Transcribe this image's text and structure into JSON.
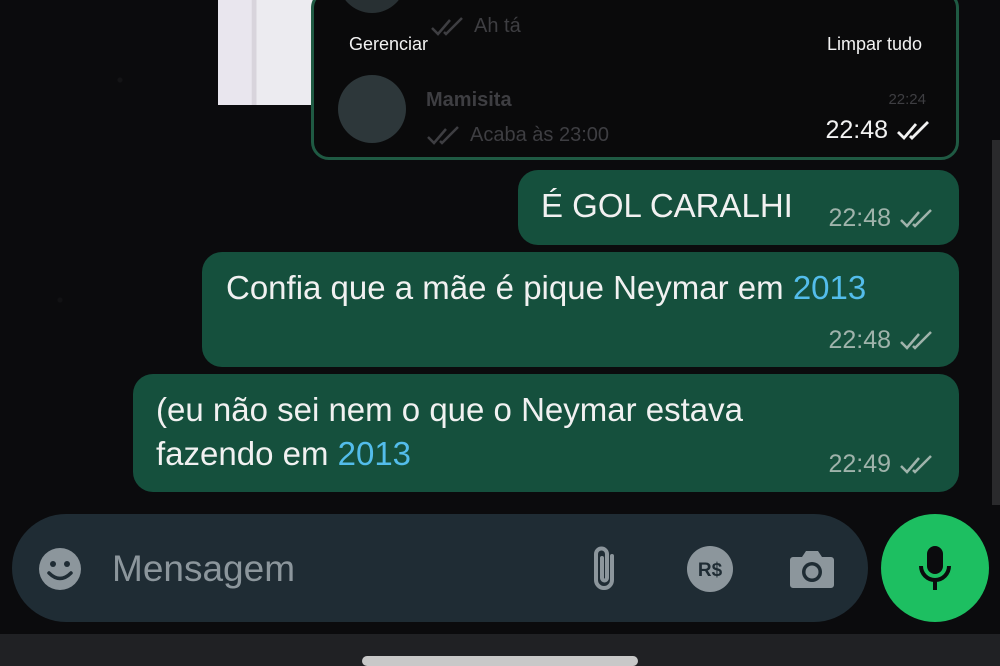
{
  "quoted_card": {
    "faded_top_status": "Ah tá",
    "manage_label": "Gerenciar",
    "clear_all_label": "Limpar tudo",
    "contact_name": "Mamisita",
    "contact_time": "22:24",
    "contact_preview": "Acaba às 23:00",
    "time": "22:48"
  },
  "messages": [
    {
      "line1": "É GOL CARALHI",
      "time": "22:48"
    },
    {
      "line1_prefix": "Confia que a mãe é pique Neymar em ",
      "line1_link": "2013",
      "time": "22:48"
    },
    {
      "line1": "(eu não sei nem o que o Neymar estava",
      "line2_prefix": "fazendo em ",
      "line2_link": "2013",
      "time": "22:49"
    }
  ],
  "composer": {
    "placeholder": "Mensagem",
    "icons": [
      "emoji-icon",
      "attach-icon",
      "payment-icon",
      "camera-icon",
      "mic-icon"
    ]
  },
  "colors": {
    "bubble": "#15503d",
    "link": "#53bdeb",
    "send_button": "#1dbf61",
    "input_bar": "#1f2c34"
  }
}
